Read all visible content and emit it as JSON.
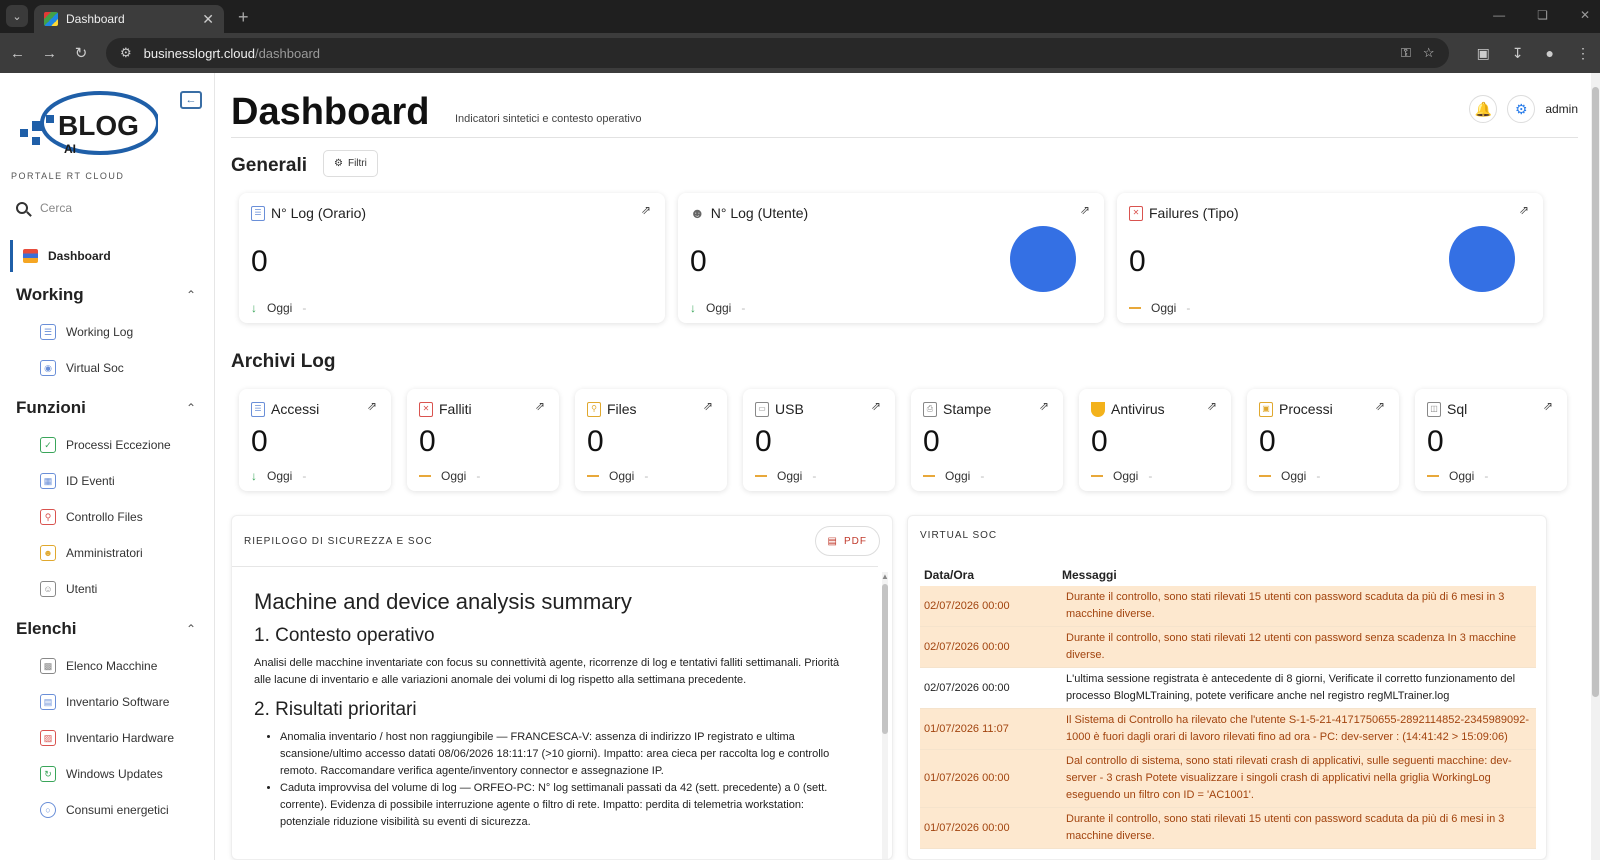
{
  "browser": {
    "tab_title": "Dashboard",
    "url_host": "businesslogrt.cloud",
    "url_path": "/dashboard"
  },
  "sidebar": {
    "logo_text": "BLOG",
    "logo_sub": "AI",
    "portal_label": "PORTALE RT CLOUD",
    "search_placeholder": "Cerca",
    "dashboard_label": "Dashboard",
    "sections": [
      {
        "title": "Working",
        "items": [
          "Working Log",
          "Virtual Soc"
        ]
      },
      {
        "title": "Funzioni",
        "items": [
          "Processi Eccezione",
          "ID Eventi",
          "Controllo Files",
          "Amministratori",
          "Utenti"
        ]
      },
      {
        "title": "Elenchi",
        "items": [
          "Elenco Macchine",
          "Inventario Software",
          "Inventario Hardware",
          "Windows Updates",
          "Consumi energetici"
        ]
      }
    ]
  },
  "header": {
    "title": "Dashboard",
    "subtitle": "Indicatori sintetici e contesto operativo",
    "user": "admin"
  },
  "generali": {
    "title": "Generali",
    "filter_label": "Filtri",
    "cards": [
      {
        "title": "N° Log (Orario)",
        "value": "0",
        "period": "Oggi",
        "trend": "down"
      },
      {
        "title": "N° Log (Utente)",
        "value": "0",
        "period": "Oggi",
        "trend": "down"
      },
      {
        "title": "Failures (Tipo)",
        "value": "0",
        "period": "Oggi",
        "trend": "flat"
      }
    ]
  },
  "archivi": {
    "title": "Archivi Log",
    "cards": [
      {
        "title": "Accessi",
        "value": "0",
        "period": "Oggi",
        "trend": "down"
      },
      {
        "title": "Falliti",
        "value": "0",
        "period": "Oggi",
        "trend": "flat"
      },
      {
        "title": "Files",
        "value": "0",
        "period": "Oggi",
        "trend": "flat"
      },
      {
        "title": "USB",
        "value": "0",
        "period": "Oggi",
        "trend": "flat"
      },
      {
        "title": "Stampe",
        "value": "0",
        "period": "Oggi",
        "trend": "flat"
      },
      {
        "title": "Antivirus",
        "value": "0",
        "period": "Oggi",
        "trend": "flat"
      },
      {
        "title": "Processi",
        "value": "0",
        "period": "Oggi",
        "trend": "flat"
      },
      {
        "title": "Sql",
        "value": "0",
        "period": "Oggi",
        "trend": "flat"
      }
    ]
  },
  "summary": {
    "panel_title": "RIEPILOGO DI SICUREZZA E SOC",
    "pdf_label": "PDF",
    "h1": "Machine and device analysis summary",
    "s1_title": "1. Contesto operativo",
    "s1_text": "Analisi delle macchine inventariate con focus su connettività agente, ricorrenze di log e tentativi falliti settimanali. Priorità alle lacune di inventario e alle variazioni anomale dei volumi di log rispetto alla settimana precedente.",
    "s2_title": "2. Risultati prioritari",
    "bullets": [
      "Anomalia inventario / host non raggiungibile — FRANCESCA-V: assenza di indirizzo IP registrato e ultima scansione/ultimo accesso datati 08/06/2026 18:11:17 (>10 giorni). Impatto: area cieca per raccolta log e controllo remoto. Raccomandare verifica agente/inventory connector e assegnazione IP.",
      "Caduta improvvisa del volume di log — ORFEO-PC: N° log settimanali passati da 42 (sett. precedente) a 0 (sett. corrente). Evidenza di possibile interruzione agente o filtro di rete. Impatto: perdita di telemetria workstation: potenziale riduzione visibilità su eventi di sicurezza."
    ]
  },
  "vsoc": {
    "panel_title": "VIRTUAL SOC",
    "col_date": "Data/Ora",
    "col_msg": "Messaggi",
    "rows": [
      {
        "date": "02/07/2026 00:00",
        "msg": "Durante il controllo, sono stati rilevati 15 utenti con password scaduta da più di 6 mesi in 3 macchine diverse.",
        "hi": true
      },
      {
        "date": "02/07/2026 00:00",
        "msg": "Durante il controllo, sono stati rilevati 12 utenti con password senza scadenza In 3 macchine diverse.",
        "hi": true
      },
      {
        "date": "02/07/2026 00:00",
        "msg": "L'ultima sessione registrata è antecedente di 8 giorni, Verificate il corretto funzionamento del processo BlogMLTraining, potete verificare anche nel registro regMLTrainer.log",
        "hi": false
      },
      {
        "date": "01/07/2026 11:07",
        "msg": "Il Sistema di Controllo ha rilevato che l'utente S-1-5-21-4171750655-2892114852-2345989092-1000 è fuori dagli orari di lavoro rilevati fino ad ora - PC: dev-server : (14:41:42 > 15:09:06)",
        "hi": true
      },
      {
        "date": "01/07/2026 00:00",
        "msg": "Dal controllo di sistema, sono stati rilevati crash di applicativi, sulle seguenti macchine: dev-server - 3 crash Potete visualizzare i singoli crash di applicativi nella griglia WorkingLog eseguendo un filtro con ID = 'AC1001'.",
        "hi": true
      },
      {
        "date": "01/07/2026 00:00",
        "msg": "Durante il controllo, sono stati rilevati 15 utenti con password scaduta da più di 6 mesi in 3 macchine diverse.",
        "hi": true
      }
    ]
  }
}
